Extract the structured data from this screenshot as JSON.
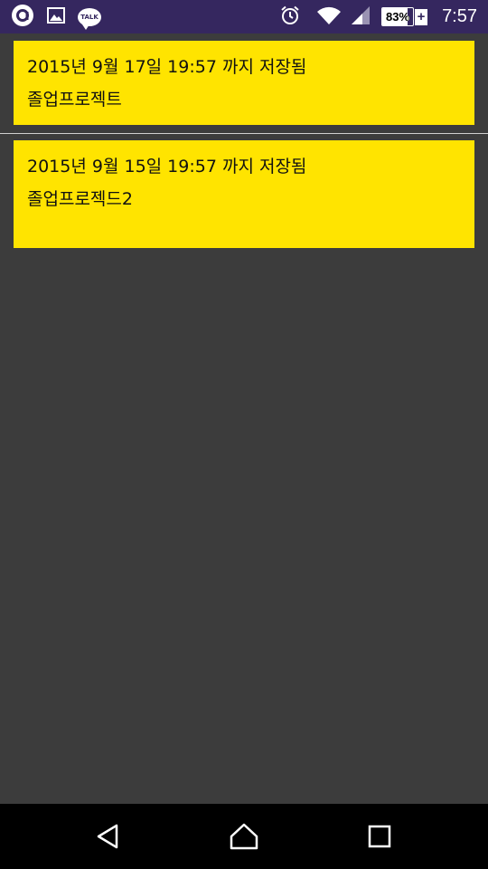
{
  "status_bar": {
    "battery_percent": "83%",
    "battery_level": 0.83,
    "battery_charging_symbol": "+",
    "time": "7:57",
    "talk_icon_label": "TALK",
    "icons": [
      "app-circle-icon",
      "image-icon",
      "kakaotalk-icon",
      "alarm-icon",
      "wifi-icon",
      "signal-icon",
      "battery-icon"
    ]
  },
  "notes": [
    {
      "saved_text": "2015년 9월 17일 19:57 까지 저장됨",
      "title": "졸업프로젝트"
    },
    {
      "saved_text": "2015년 9월 15일 19:57 까지 저장됨",
      "title": "졸업프로젝드2"
    }
  ],
  "nav_bar": {
    "icons": [
      "back-icon",
      "home-icon",
      "recents-icon"
    ]
  },
  "colors": {
    "status_bar": "#35275f",
    "background": "#3c3c3c",
    "card": "#ffe400",
    "nav_bar": "#000000"
  }
}
